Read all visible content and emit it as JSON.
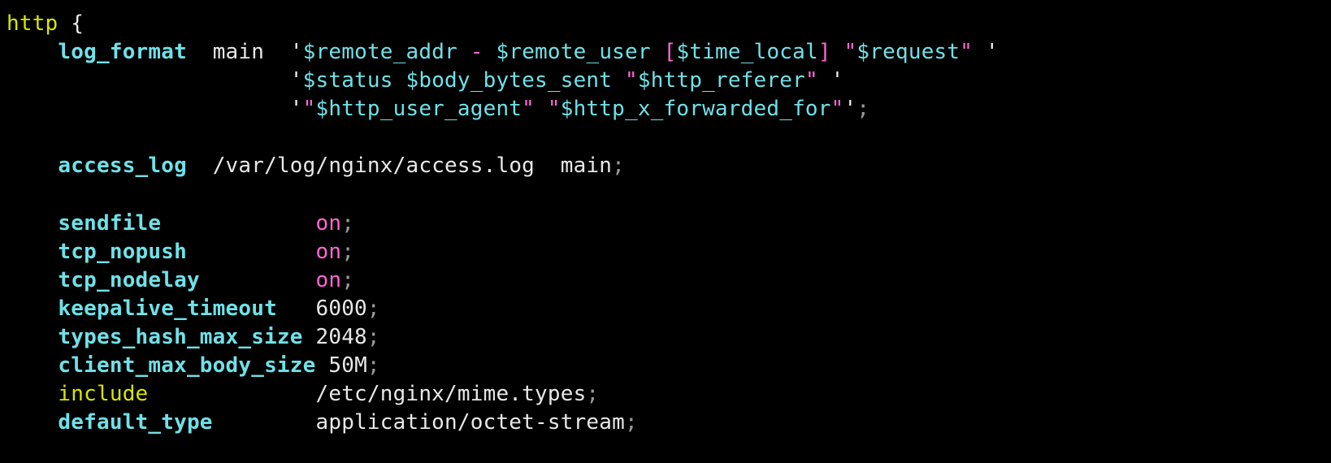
{
  "block_keyword": "http",
  "open_brace": "{",
  "log_format": {
    "directive": "log_format",
    "name": "main",
    "line1": {
      "v_remote_addr": "$remote_addr",
      "sep1": " - ",
      "v_remote_user": "$remote_user",
      "sep2": " [",
      "v_time_local": "$time_local",
      "sep3": "] \"",
      "v_request": "$request",
      "sep4": "\" "
    },
    "line2": {
      "v_status": "$status",
      "sep1": " ",
      "v_body_bytes_sent": "$body_bytes_sent",
      "sep2": " \"",
      "v_http_referer": "$http_referer",
      "sep3": "\" "
    },
    "line3": {
      "sep1": "\"",
      "v_http_user_agent": "$http_user_agent",
      "sep2": "\" \"",
      "v_http_x_forwarded_for": "$http_x_forwarded_for",
      "sep3": "\""
    }
  },
  "access_log": {
    "directive": "access_log",
    "path": "/var/log/nginx/access.log",
    "name": "main"
  },
  "sendfile": {
    "directive": "sendfile",
    "value": "on"
  },
  "tcp_nopush": {
    "directive": "tcp_nopush",
    "value": "on"
  },
  "tcp_nodelay": {
    "directive": "tcp_nodelay",
    "value": "on"
  },
  "keepalive_timeout": {
    "directive": "keepalive_timeout",
    "value": "6000"
  },
  "types_hash_max_size": {
    "directive": "types_hash_max_size",
    "value": "2048"
  },
  "client_max_body_size": {
    "directive": "client_max_body_size",
    "value": "50M"
  },
  "include": {
    "directive": "include",
    "value": "/etc/nginx/mime.types"
  },
  "default_type": {
    "directive": "default_type",
    "value": "application/octet-stream"
  }
}
